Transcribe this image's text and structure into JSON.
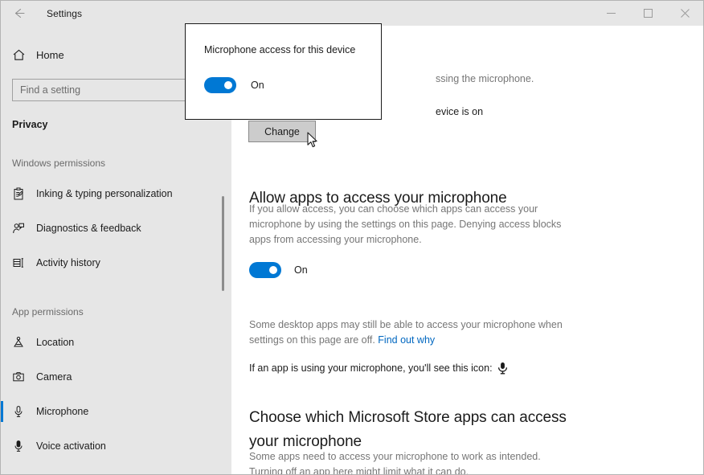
{
  "window": {
    "title": "Settings",
    "back_icon": "back-arrow-icon",
    "minimize_label": "Minimize",
    "maximize_label": "Maximize",
    "close_label": "Close"
  },
  "sidebar": {
    "home": {
      "label": "Home",
      "icon": "home-icon"
    },
    "search": {
      "placeholder": "Find a setting",
      "value": ""
    },
    "category": "Privacy",
    "groups": [
      {
        "heading": "Windows permissions",
        "items": [
          {
            "label": "Inking & typing personalization",
            "icon": "clipboard-pen-icon",
            "selected": false
          },
          {
            "label": "Diagnostics & feedback",
            "icon": "person-feedback-icon",
            "selected": false
          },
          {
            "label": "Activity history",
            "icon": "activity-history-icon",
            "selected": false
          }
        ]
      },
      {
        "heading": "App permissions",
        "items": [
          {
            "label": "Location",
            "icon": "location-icon",
            "selected": false
          },
          {
            "label": "Camera",
            "icon": "camera-icon",
            "selected": false
          },
          {
            "label": "Microphone",
            "icon": "microphone-icon",
            "selected": true
          },
          {
            "label": "Voice activation",
            "icon": "voice-activation-icon",
            "selected": false
          }
        ]
      }
    ]
  },
  "main": {
    "occluded_line_1": "ssing the microphone.",
    "occluded_line_2": "evice is on",
    "change_button": "Change",
    "section_apps": {
      "heading": "Allow apps to access your microphone",
      "description": "If you allow access, you can choose which apps can access your microphone by using the settings on this page. Denying access blocks apps from accessing your microphone.",
      "toggle_state": "On",
      "note_prefix": "Some desktop apps may still be able to access your microphone when settings on this page are off. ",
      "note_link": "Find out why",
      "icon_hint": "If an app is using your microphone, you'll see this icon:",
      "icon_name": "microphone-icon"
    },
    "section_store": {
      "heading": "Choose which Microsoft Store apps can access your microphone",
      "description": "Some apps need to access your microphone to work as intended. Turning off an app here might limit what it can do."
    }
  },
  "popup": {
    "title": "Microphone access for this device",
    "toggle_state": "On"
  },
  "colors": {
    "accent": "#0078d4",
    "link": "#0067c0",
    "sidebar_bg": "#e6e6e6",
    "text": "#1b1b1b",
    "muted": "#767676"
  }
}
